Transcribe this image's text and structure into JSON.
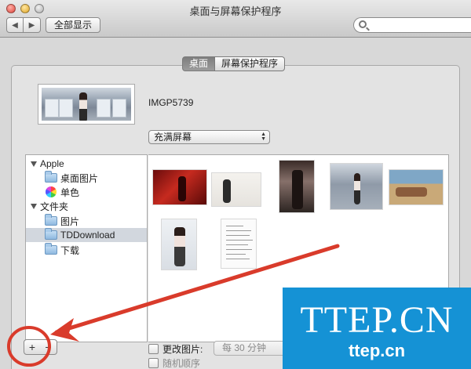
{
  "window": {
    "title": "桌面与屏幕保护程序"
  },
  "toolbar": {
    "back": "◀",
    "forward": "▶",
    "show_all": "全部显示",
    "search_placeholder": ""
  },
  "tabs": [
    {
      "label": "桌面",
      "active": true
    },
    {
      "label": "屏幕保护程序",
      "active": false
    }
  ],
  "current": {
    "image_name": "IMGP5739",
    "fit_option": "充满屏幕"
  },
  "sidebar": {
    "groups": [
      {
        "label": "Apple",
        "items": [
          {
            "label": "桌面图片",
            "icon": "folder-icon"
          },
          {
            "label": "单色",
            "icon": "color-wheel-icon"
          }
        ]
      },
      {
        "label": "文件夹",
        "items": [
          {
            "label": "图片",
            "icon": "folder-icon"
          },
          {
            "label": "TDDownload",
            "icon": "folder-icon",
            "selected": true
          },
          {
            "label": "下载",
            "icon": "folder-icon"
          }
        ]
      }
    ]
  },
  "bottom": {
    "add": "+",
    "remove": "−",
    "change_picture": "更改图片:",
    "interval": "每 30 分钟",
    "random_order": "随机顺序"
  },
  "watermark": {
    "big": "TTEP.CN",
    "small": "ttep.cn"
  },
  "colors": {
    "annotation_red": "#d93b2b",
    "watermark_blue": "#1592d5",
    "selection": "#d2d7de"
  }
}
